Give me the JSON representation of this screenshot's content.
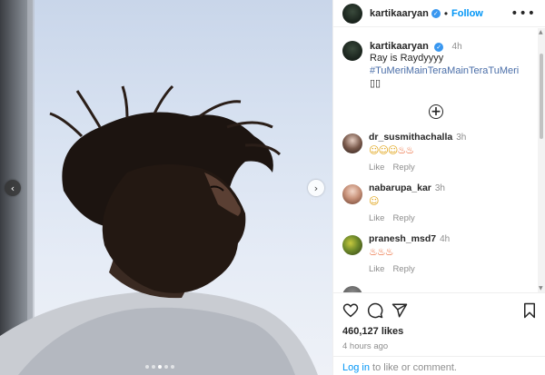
{
  "header": {
    "username": "kartikaaryan",
    "verified_icon": "verified-badge-icon",
    "separator": "•",
    "follow_label": "Follow",
    "more_icon": "more-options-icon"
  },
  "caption": {
    "username": "kartikaaryan",
    "time": "4h",
    "line1": "Ray is Raydyyyy",
    "hashtag": "#TuMeriMainTeraMainTeraTuMeri",
    "trailing": " ▯▯"
  },
  "load_more_icon": "plus-circle-icon",
  "comments": [
    {
      "username": "dr_susmithachalla",
      "time": "3h",
      "emoji": "🥰🥰🥰🔥🔥",
      "like": "Like",
      "reply": "Reply"
    },
    {
      "username": "nabarupa_kar",
      "time": "3h",
      "emoji": "🥰",
      "like": "Like",
      "reply": "Reply"
    },
    {
      "username": "pranesh_msd7",
      "time": "4h",
      "emoji": "🔥🔥🔥",
      "like": "Like",
      "reply": "Reply"
    }
  ],
  "footer": {
    "likes": "460,127 likes",
    "ago": "4 hours ago",
    "login_link": "Log in",
    "login_rest": " to like or comment."
  },
  "photo": {
    "prev_icon": "‹",
    "next_icon": "›",
    "slide_count": 5,
    "active_slide": 2
  },
  "colors": {
    "accent": "#0095f6",
    "verified": "#3897f0",
    "text": "#262626",
    "muted": "#8e8e8e"
  }
}
